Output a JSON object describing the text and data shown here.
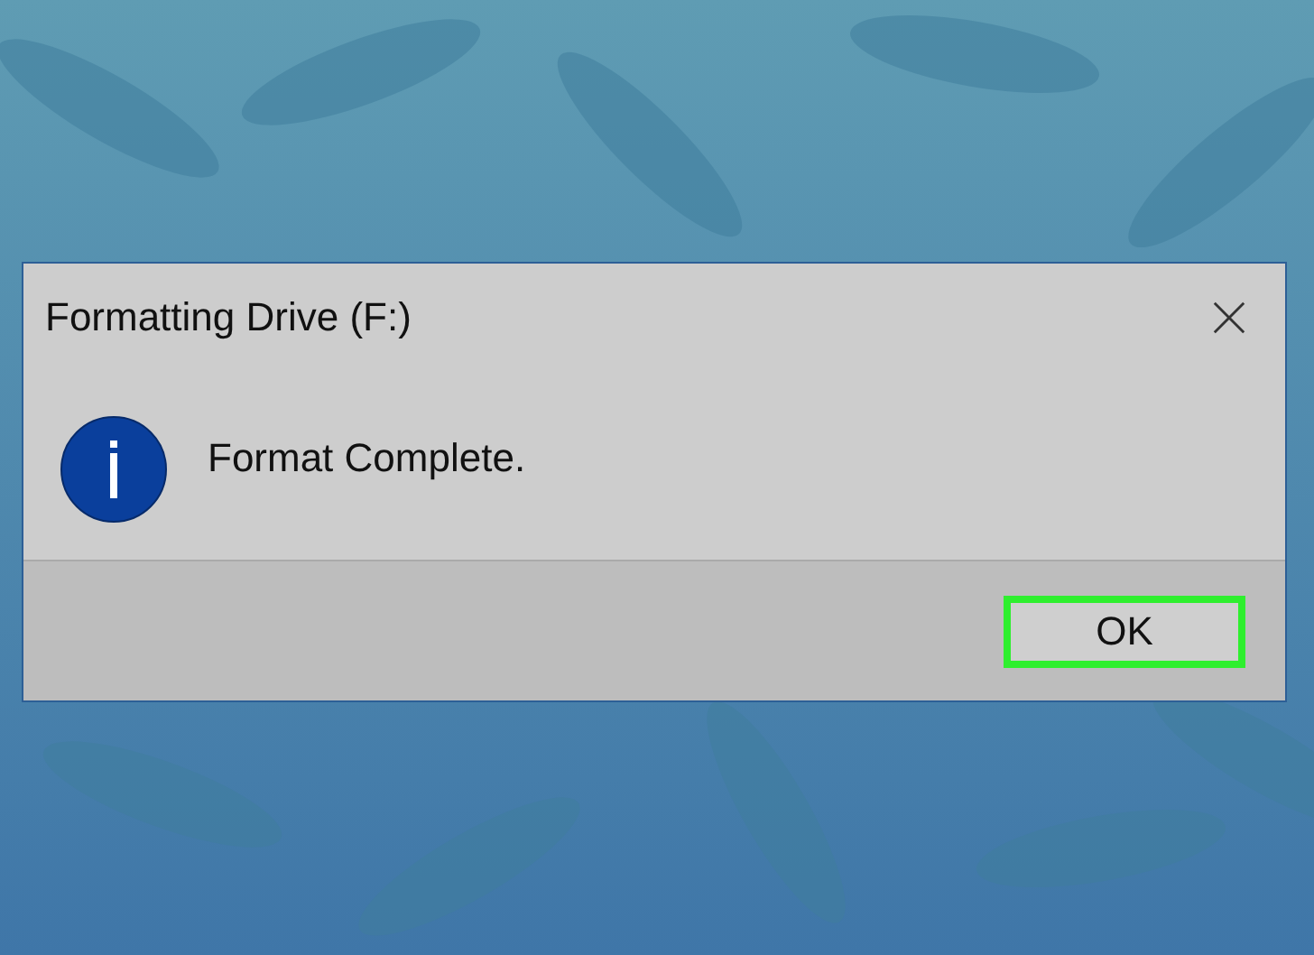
{
  "dialog": {
    "title": "Formatting Drive (F:)",
    "message": "Format Complete.",
    "buttons": [
      {
        "label": "OK",
        "highlighted": true
      }
    ]
  }
}
